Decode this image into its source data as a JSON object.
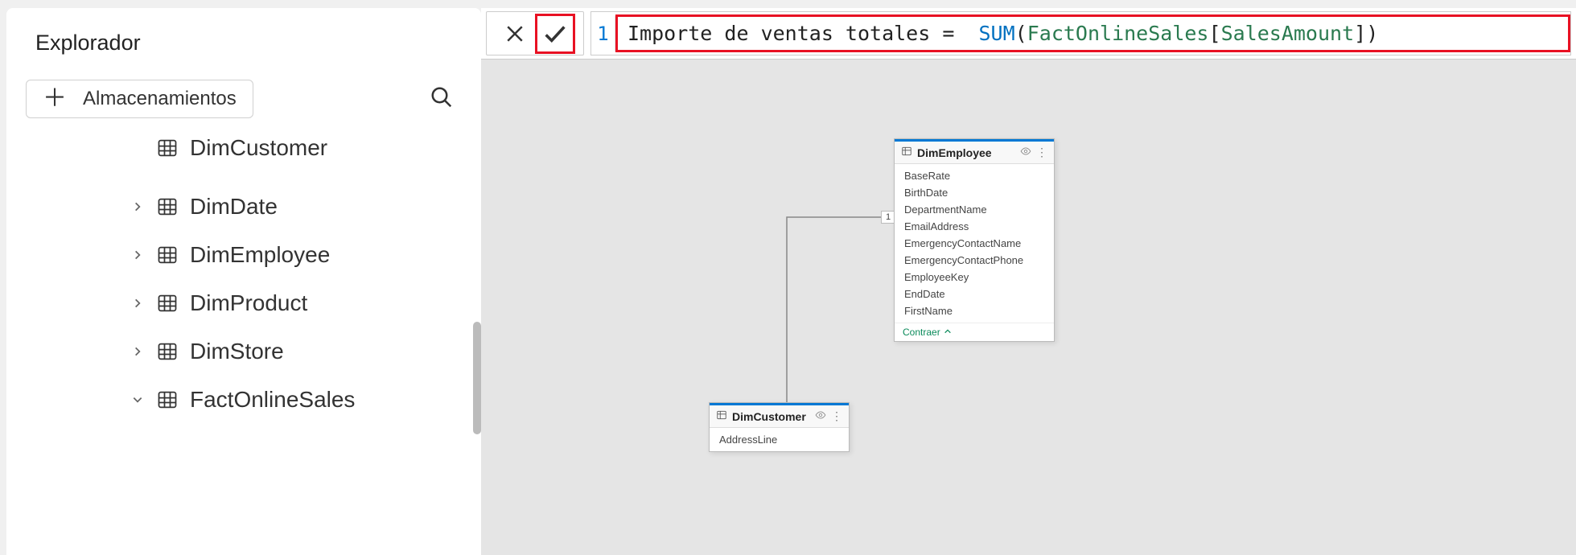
{
  "sidebar": {
    "title": "Explorador",
    "add_label": "Almacenamientos",
    "cut_item": "DimCustomer",
    "items": [
      {
        "label": "DimDate",
        "expanded": false
      },
      {
        "label": "DimEmployee",
        "expanded": false
      },
      {
        "label": "DimProduct",
        "expanded": false
      },
      {
        "label": "DimStore",
        "expanded": false
      },
      {
        "label": "FactOnlineSales",
        "expanded": true
      }
    ]
  },
  "formula": {
    "line": "1",
    "prefix": "Importe de ventas totales = ",
    "func": "SUM",
    "open": "(",
    "table": "FactOnlineSales",
    "col_open": "[",
    "column": "SalesAmount",
    "col_close": "]",
    "close": ")"
  },
  "canvas": {
    "tables": {
      "dimEmployee": {
        "name": "DimEmployee",
        "fields": [
          "BaseRate",
          "BirthDate",
          "DepartmentName",
          "EmailAddress",
          "EmergencyContactName",
          "EmergencyContactPhone",
          "EmployeeKey",
          "EndDate",
          "FirstName"
        ],
        "footer": "Contraer"
      },
      "dimCustomer": {
        "name": "DimCustomer",
        "fields": [
          "AddressLine"
        ]
      }
    },
    "rel_label": "1"
  }
}
